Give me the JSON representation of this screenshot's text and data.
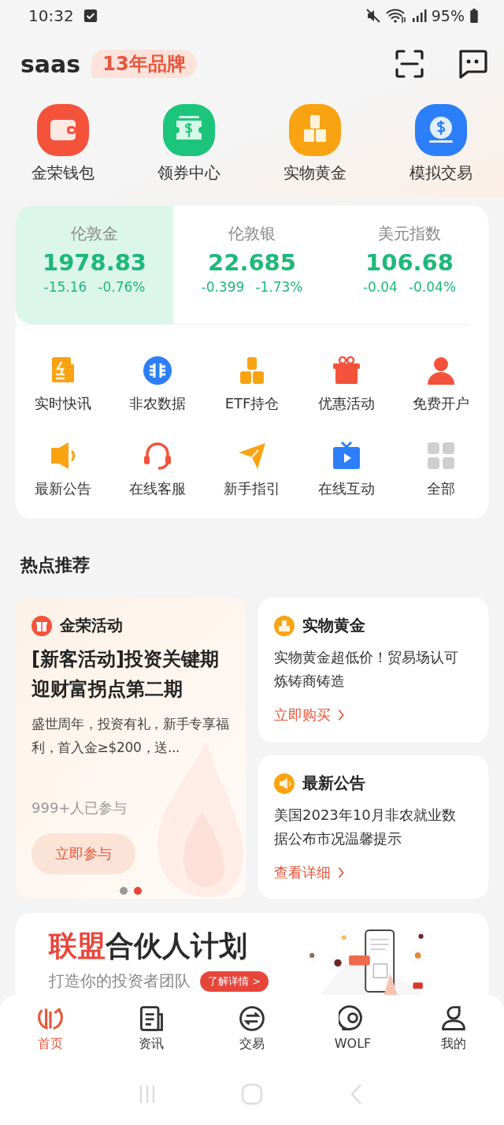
{
  "status_bar": {
    "time": "10:32",
    "battery": "95%"
  },
  "header": {
    "brand": "saas",
    "badge": "13年品牌"
  },
  "shortcuts": [
    {
      "label": "金荣钱包",
      "kind": "wallet"
    },
    {
      "label": "领券中心",
      "kind": "coupon"
    },
    {
      "label": "实物黄金",
      "kind": "gold"
    },
    {
      "label": "模拟交易",
      "kind": "coin"
    }
  ],
  "quotes": [
    {
      "name": "伦敦金",
      "price": "1978.83",
      "change": "-15.16",
      "percent": "-0.76%",
      "selected": true
    },
    {
      "name": "伦敦银",
      "price": "22.685",
      "change": "-0.399",
      "percent": "-1.73%",
      "selected": false
    },
    {
      "name": "美元指数",
      "price": "106.68",
      "change": "-0.04",
      "percent": "-0.04%",
      "selected": false
    }
  ],
  "services": [
    {
      "label": "实时快讯",
      "kind": "news"
    },
    {
      "label": "非农数据",
      "kind": "data"
    },
    {
      "label": "ETF持仓",
      "kind": "bars"
    },
    {
      "label": "优惠活动",
      "kind": "gift"
    },
    {
      "label": "免费开户",
      "kind": "person"
    },
    {
      "label": "最新公告",
      "kind": "speaker"
    },
    {
      "label": "在线客服",
      "kind": "headset"
    },
    {
      "label": "新手指引",
      "kind": "plane"
    },
    {
      "label": "在线互动",
      "kind": "tv"
    },
    {
      "label": "全部",
      "kind": "grid"
    }
  ],
  "hot": {
    "title": "热点推荐",
    "featured": {
      "tag": "金荣活动",
      "title": "[新客活动]投资关键期迎财富拐点第二期",
      "description": "盛世周年，投资有礼，新手专享福利，首入金≥$200，送...",
      "participants": "999+人已参与",
      "button": "立即参与",
      "dots": [
        {
          "selected": false
        },
        {
          "selected": true
        }
      ]
    },
    "cards": [
      {
        "tag": "实物黄金",
        "kind": "gold",
        "text": "实物黄金超低价！贸易场认可炼铸商铸造",
        "link": "立即购买"
      },
      {
        "tag": "最新公告",
        "kind": "speaker",
        "text": "美国2023年10月非农就业数据公布市况温馨提示",
        "link": "查看详细"
      }
    ]
  },
  "banner": {
    "title_highlight": "联盟",
    "title_rest": "合伙人计划",
    "subtitle": "打造你的投资者团队",
    "button": "了解详情 >"
  },
  "tabs": [
    {
      "label": "首页",
      "kind": "home",
      "selected": true
    },
    {
      "label": "资讯",
      "kind": "news",
      "selected": false
    },
    {
      "label": "交易",
      "kind": "trade",
      "selected": false
    },
    {
      "label": "WOLF",
      "kind": "chat",
      "selected": false
    },
    {
      "label": "我的",
      "kind": "me",
      "selected": false
    }
  ]
}
